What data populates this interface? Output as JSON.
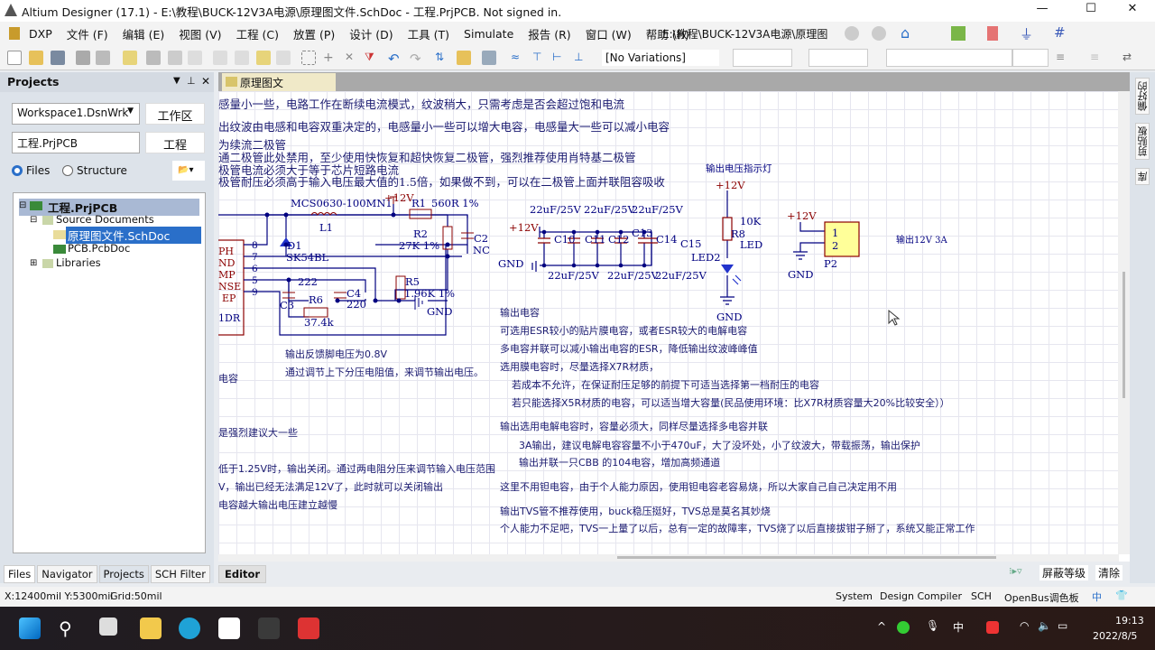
{
  "title": "Altium Designer (17.1) - E:\\教程\\BUCK-12V3A电源\\原理图文件.SchDoc - 工程.PrjPCB. Not signed in.",
  "window_controls": {
    "minimize": "—",
    "maximize": "☐",
    "close": "✕"
  },
  "menu": [
    "DXP",
    "文件 (F)",
    "编辑 (E)",
    "视图 (V)",
    "工程 (C)",
    "放置 (P)",
    "设计 (D)",
    "工具 (T)",
    "Simulate",
    "报告 (R)",
    "窗口 (W)",
    "帮助 (H)"
  ],
  "path_combo": "E:\\教程\\BUCK-12V3A电源\\原理图",
  "variations": "[No Variations]",
  "panel": {
    "title": "Projects",
    "workspace": "Workspace1.DsnWrk",
    "workspace_btn": "工作区",
    "project": "工程.PrjPCB",
    "project_btn": "工程",
    "radio_files": "Files",
    "radio_structure": "Structure",
    "tree": {
      "project": "工程.PrjPCB",
      "source": "Source Documents",
      "schdoc": "原理图文件.SchDoc",
      "pcbdoc": "PCB.PcbDoc",
      "libraries": "Libraries"
    },
    "bottom_tabs": [
      "Files",
      "Navigator",
      "Projects",
      "SCH Filter"
    ]
  },
  "doc_tab": "原理图文件.SchDoc",
  "editor_tab": "Editor",
  "right_tabs": [
    "偏好的",
    "剪贴板",
    "库"
  ],
  "mask_level": "屏蔽等级",
  "clear": "清除",
  "notes_top": [
    "感量小一些，电路工作在断续电流模式，纹波稍大，只需考虑是否会超过饱和电流",
    "出纹波由电感和电容双重决定的，电感量小一些可以增大电容，电感量大一些可以减小电容",
    "为续流二极管",
    "通二极管此处禁用，至少使用快恢复和超快恢复二极管，强烈推荐使用肖特基二极管",
    "极管电流必须大于等于芯片短路电流",
    "极管耐压必须高于输入电压最大值的1.5倍，如果做不到，可以在二极管上面并联阻容吸收"
  ],
  "notes_left": [
    "输出反馈脚电压为0.8V",
    "通过调节上下分压电阻值，来调节输出电压。",
    "电容",
    "是强烈建议大一些",
    "低于1.25V时，输出关闭。通过两电阻分压来调节输入电压范围",
    "V，输出已经无法满足12V了，此时就可以关闭输出",
    "电容越大输出电压建立越慢"
  ],
  "notes_right": [
    "输出电容",
    "可选用ESR较小的贴片膜电容，或者ESR较大的电解电容",
    "多电容并联可以减小输出电容的ESR，降低输出纹波峰峰值",
    "选用膜电容时，尽量选择X7R材质，",
    "若成本不允许，在保证耐压足够的前提下可适当选择第一档耐压的电容",
    "若只能选择X5R材质的电容，可以适当增大容量(民品使用环境：比X7R材质容量大20%比较安全））",
    "输出选用电解电容时，容量必须大，同样尽量选择多电容并联",
    "3A输出，建议电解电容容量不小于470uF，大了没坏处，小了纹波大，带载振荡，输出保护",
    "输出并联一只CBB 的104电容，增加高频通道",
    "这里不用钽电容，由于个人能力原因，使用钽电容老容易烧，所以大家自己自己决定用不用",
    "输出TVS管不推荐使用，buck稳压挺好，TVS总是莫名其妙烧",
    "个人能力不足吧，TVS一上量了以后，总有一定的故障率，TVS烧了以后直接拔钳子掰了，系统又能正常工作"
  ],
  "schematic": {
    "ic_pins": [
      "PH",
      "ND",
      "MP",
      "NSE",
      "EP"
    ],
    "ic_pin_nums": [
      "8",
      "7",
      "6",
      "5",
      "9"
    ],
    "ic_part": "1DR",
    "L1": "MCS0630-100MN1",
    "L1_des": "L1",
    "D1": "D1",
    "D1_val": "SK54BL",
    "R1": "R1",
    "R1_val": "560R 1%",
    "R2": "R2",
    "R2_val": "27K 1%",
    "C2": "C2",
    "C2_val": "NC",
    "R5": "R5",
    "R5_val": "1.96K 1%",
    "R6": "R6",
    "R6_val": "37.4k",
    "C3": "C3",
    "C3_val": "222",
    "C4": "C4",
    "C4_val": "220",
    "vcc": "+12V",
    "gnd": "GND",
    "caps": [
      "C10",
      "C11",
      "C12",
      "C13",
      "C14",
      "C15"
    ],
    "cap_val": "22uF/25V",
    "led_title": "输出电压指示灯",
    "R8": "R8",
    "R8_val": "10K",
    "LED": "LED",
    "LED2": "LED2",
    "P2": "P2",
    "P2_pins": [
      "1",
      "2"
    ],
    "out_label": "输出12V 3A"
  },
  "status": {
    "coords": "X:12400mil Y:5300mil",
    "grid": "Grid:50mil",
    "buttons": [
      "System",
      "Design Compiler",
      "SCH",
      "OpenBus调色板"
    ],
    "ime": "中"
  },
  "taskbar": {
    "time": "19:13",
    "date": "2022/8/5",
    "ime": "中"
  }
}
